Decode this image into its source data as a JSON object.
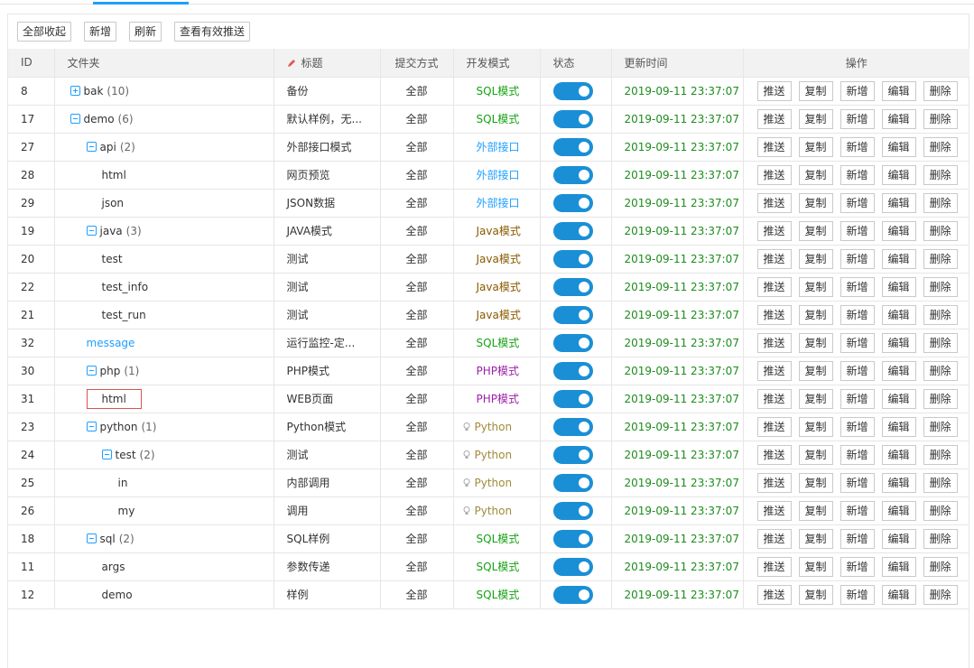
{
  "toolbar": {
    "collapse_all": "全部收起",
    "add": "新增",
    "refresh": "刷新",
    "view_push": "查看有效推送"
  },
  "columns": {
    "id": "ID",
    "folder": "文件夹",
    "title": "标题",
    "submit": "提交方式",
    "dev_mode": "开发模式",
    "status": "状态",
    "updated": "更新时间",
    "actions": "操作"
  },
  "action_labels": {
    "push": "推送",
    "copy": "复制",
    "add": "新增",
    "edit": "编辑",
    "delete": "删除"
  },
  "colors": {
    "accent": "#1e9fff",
    "switch": "#1a8fd6",
    "sql": "#15a315",
    "external": "#1e9fff",
    "java": "#8a5a00",
    "php": "#9c1fa8",
    "python": "#a08a3a",
    "time": "#1d8c1d"
  },
  "rows": [
    {
      "id": "8",
      "name": "bak",
      "count": "(10)",
      "depth": 0,
      "expander": "plus",
      "title": "备份",
      "submit": "全部",
      "mode": "SQL模式",
      "mode_type": "sql",
      "enabled": true,
      "updated": "2019-09-11 23:37:07"
    },
    {
      "id": "17",
      "name": "demo",
      "count": "(6)",
      "depth": 0,
      "expander": "minus",
      "title": "默认样例，无...",
      "submit": "全部",
      "mode": "SQL模式",
      "mode_type": "sql",
      "enabled": true,
      "updated": "2019-09-11 23:37:07"
    },
    {
      "id": "27",
      "name": "api",
      "count": "(2)",
      "depth": 1,
      "expander": "minus",
      "title": "外部接口模式",
      "submit": "全部",
      "mode": "外部接口",
      "mode_type": "ext",
      "enabled": true,
      "updated": "2019-09-11 23:37:07"
    },
    {
      "id": "28",
      "name": "html",
      "count": "",
      "depth": 2,
      "expander": "none",
      "title": "网页预览",
      "submit": "全部",
      "mode": "外部接口",
      "mode_type": "ext",
      "enabled": true,
      "updated": "2019-09-11 23:37:07"
    },
    {
      "id": "29",
      "name": "json",
      "count": "",
      "depth": 2,
      "expander": "none",
      "title": "JSON数据",
      "submit": "全部",
      "mode": "外部接口",
      "mode_type": "ext",
      "enabled": true,
      "updated": "2019-09-11 23:37:07"
    },
    {
      "id": "19",
      "name": "java",
      "count": "(3)",
      "depth": 1,
      "expander": "minus",
      "title": "JAVA模式",
      "submit": "全部",
      "mode": "Java模式",
      "mode_type": "java",
      "enabled": true,
      "updated": "2019-09-11 23:37:07"
    },
    {
      "id": "20",
      "name": "test",
      "count": "",
      "depth": 2,
      "expander": "none",
      "title": "测试",
      "submit": "全部",
      "mode": "Java模式",
      "mode_type": "java",
      "enabled": true,
      "updated": "2019-09-11 23:37:07"
    },
    {
      "id": "22",
      "name": "test_info",
      "count": "",
      "depth": 2,
      "expander": "none",
      "title": "测试",
      "submit": "全部",
      "mode": "Java模式",
      "mode_type": "java",
      "enabled": true,
      "updated": "2019-09-11 23:37:07"
    },
    {
      "id": "21",
      "name": "test_run",
      "count": "",
      "depth": 2,
      "expander": "none",
      "title": "测试",
      "submit": "全部",
      "mode": "Java模式",
      "mode_type": "java",
      "enabled": true,
      "updated": "2019-09-11 23:37:07"
    },
    {
      "id": "32",
      "name": "message",
      "count": "",
      "depth": 1,
      "expander": "link",
      "title": "运行监控-定...",
      "submit": "全部",
      "mode": "SQL模式",
      "mode_type": "sql",
      "enabled": true,
      "updated": "2019-09-11 23:37:07"
    },
    {
      "id": "30",
      "name": "php",
      "count": "(1)",
      "depth": 1,
      "expander": "minus",
      "title": "PHP模式",
      "submit": "全部",
      "mode": "PHP模式",
      "mode_type": "php",
      "enabled": true,
      "updated": "2019-09-11 23:37:07"
    },
    {
      "id": "31",
      "name": "html",
      "count": "",
      "depth": 2,
      "expander": "highlight",
      "title": "WEB页面",
      "submit": "全部",
      "mode": "PHP模式",
      "mode_type": "php",
      "enabled": true,
      "updated": "2019-09-11 23:37:07"
    },
    {
      "id": "23",
      "name": "python",
      "count": "(1)",
      "depth": 1,
      "expander": "minus",
      "title": "Python模式",
      "submit": "全部",
      "mode": "Python",
      "mode_type": "python",
      "enabled": true,
      "updated": "2019-09-11 23:37:07"
    },
    {
      "id": "24",
      "name": "test",
      "count": "(2)",
      "depth": 2,
      "expander": "minus",
      "title": "测试",
      "submit": "全部",
      "mode": "Python",
      "mode_type": "python",
      "enabled": true,
      "updated": "2019-09-11 23:37:07"
    },
    {
      "id": "25",
      "name": "in",
      "count": "",
      "depth": 3,
      "expander": "none",
      "title": "内部调用",
      "submit": "全部",
      "mode": "Python",
      "mode_type": "python",
      "enabled": true,
      "updated": "2019-09-11 23:37:07"
    },
    {
      "id": "26",
      "name": "my",
      "count": "",
      "depth": 3,
      "expander": "none",
      "title": "调用",
      "submit": "全部",
      "mode": "Python",
      "mode_type": "python",
      "enabled": true,
      "updated": "2019-09-11 23:37:07"
    },
    {
      "id": "18",
      "name": "sql",
      "count": "(2)",
      "depth": 1,
      "expander": "minus",
      "title": "SQL样例",
      "submit": "全部",
      "mode": "SQL模式",
      "mode_type": "sql",
      "enabled": true,
      "updated": "2019-09-11 23:37:07"
    },
    {
      "id": "11",
      "name": "args",
      "count": "",
      "depth": 2,
      "expander": "none",
      "title": "参数传递",
      "submit": "全部",
      "mode": "SQL模式",
      "mode_type": "sql",
      "enabled": true,
      "updated": "2019-09-11 23:37:07"
    },
    {
      "id": "12",
      "name": "demo",
      "count": "",
      "depth": 2,
      "expander": "none",
      "title": "样例",
      "submit": "全部",
      "mode": "SQL模式",
      "mode_type": "sql",
      "enabled": true,
      "updated": "2019-09-11 23:37:07"
    }
  ]
}
